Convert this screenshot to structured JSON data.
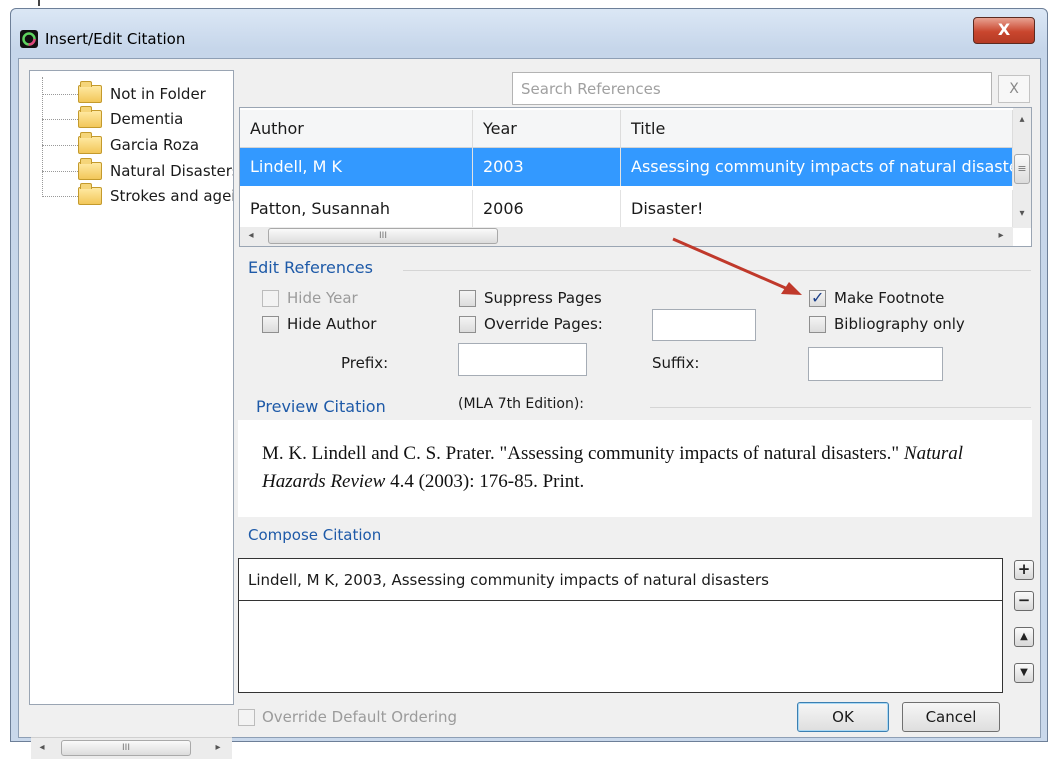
{
  "window": {
    "title": "Insert/Edit Citation",
    "close_glyph": "X"
  },
  "folders": [
    {
      "label": "Not in Folder"
    },
    {
      "label": "Dementia"
    },
    {
      "label": "Garcia Roza"
    },
    {
      "label": "Natural Disasters"
    },
    {
      "label": "Strokes and ageing"
    }
  ],
  "tree_scroll": {
    "left_glyph": "◂",
    "thumb_glyph": "III",
    "right_glyph": "▸"
  },
  "search": {
    "placeholder": "Search References",
    "clear_label": "X"
  },
  "references": {
    "columns": [
      "Author",
      "Year",
      "Title"
    ],
    "rows": [
      {
        "author": "Lindell, M K",
        "year": "2003",
        "title": "Assessing community impacts of natural disasters",
        "selected": true
      },
      {
        "author": "Patton, Susannah",
        "year": "2006",
        "title": "Disaster!",
        "selected": false
      }
    ],
    "scroll": {
      "up_glyph": "▴",
      "down_glyph": "▾",
      "left_glyph": "◂",
      "right_glyph": "▸",
      "thumb_glyph": "III",
      "vthumb_glyph": "≡"
    }
  },
  "edit_references": {
    "title": "Edit References",
    "hide_year": {
      "label": "Hide Year",
      "checked": false,
      "disabled": true
    },
    "hide_author": {
      "label": "Hide Author",
      "checked": false,
      "disabled": false
    },
    "suppress_pages": {
      "label": "Suppress Pages",
      "checked": false,
      "disabled": false
    },
    "override_pages": {
      "label": "Override Pages:",
      "checked": false,
      "disabled": false,
      "value": ""
    },
    "make_footnote": {
      "label": "Make Footnote",
      "checked": true,
      "disabled": false
    },
    "bibliography_only": {
      "label": "Bibliography only",
      "checked": false,
      "disabled": false
    },
    "prefix": {
      "label": "Prefix:",
      "value": ""
    },
    "suffix": {
      "label": "Suffix:",
      "value": ""
    }
  },
  "preview": {
    "title": "Preview Citation",
    "style": "(MLA 7th Edition):",
    "text_part1": "M. K. Lindell and C. S. Prater. \"Assessing community impacts of natural disasters.\" ",
    "journal": "Natural Hazards Review",
    "text_part2": " 4.4 (2003): 176-85. Print."
  },
  "compose": {
    "title": "Compose Citation",
    "items": [
      "Lindell, M K, 2003, Assessing community impacts of natural disasters"
    ],
    "buttons": {
      "add": "+",
      "remove": "−",
      "up": "▲",
      "down": "▼"
    }
  },
  "footer": {
    "override_ordering": {
      "label": "Override Default Ordering",
      "checked": false,
      "disabled": true
    },
    "ok_label": "OK",
    "cancel_label": "Cancel"
  },
  "colors": {
    "accent": "#1e5aa8",
    "selection": "#3399ff",
    "annotation_arrow": "#c0392b",
    "close_button": "#c9462e"
  }
}
